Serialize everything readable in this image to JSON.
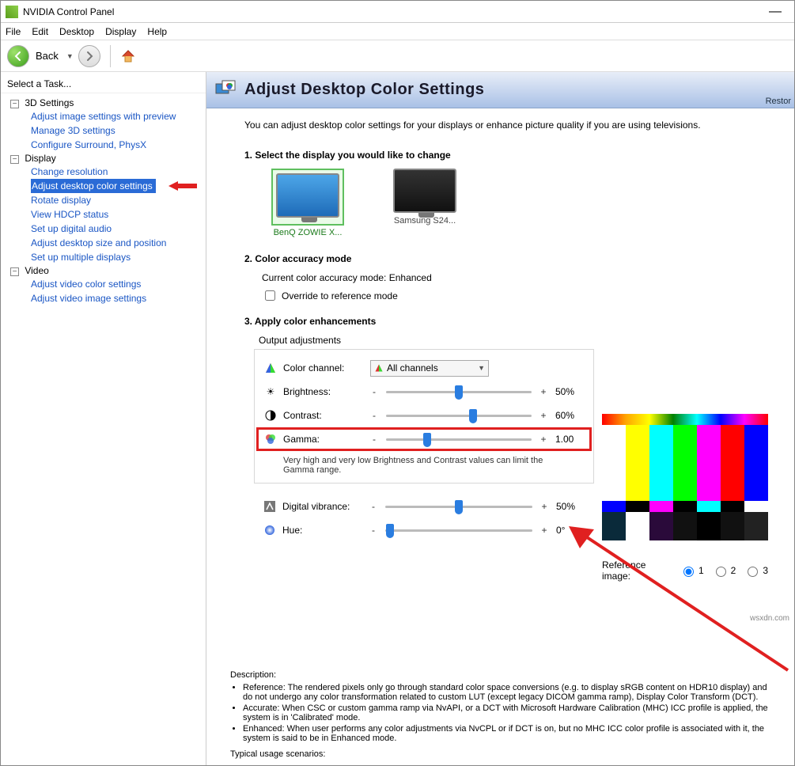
{
  "window": {
    "title": "NVIDIA Control Panel"
  },
  "menu": {
    "file": "File",
    "edit": "Edit",
    "desktop": "Desktop",
    "display": "Display",
    "help": "Help"
  },
  "toolbar": {
    "back": "Back"
  },
  "sidebar": {
    "header": "Select a Task...",
    "g3d": {
      "label": "3D Settings",
      "a": "Adjust image settings with preview",
      "b": "Manage 3D settings",
      "c": "Configure Surround, PhysX"
    },
    "disp": {
      "label": "Display",
      "a": "Change resolution",
      "b": "Adjust desktop color settings",
      "c": "Rotate display",
      "d": "View HDCP status",
      "e": "Set up digital audio",
      "f": "Adjust desktop size and position",
      "g": "Set up multiple displays"
    },
    "video": {
      "label": "Video",
      "a": "Adjust video color settings",
      "b": "Adjust video image settings"
    }
  },
  "page": {
    "title": "Adjust Desktop Color Settings",
    "restore": "Restor",
    "intro": "You can adjust desktop color settings for your displays or enhance picture quality if you are using televisions.",
    "step1": "1. Select the display you would like to change",
    "disp1": "BenQ ZOWIE X...",
    "disp2": "Samsung S24...",
    "step2": "2. Color accuracy mode",
    "curmode": "Current color accuracy mode: Enhanced",
    "override": "Override to reference mode",
    "step3": "3. Apply color enhancements",
    "outadj": "Output adjustments",
    "colorchannel": "Color channel:",
    "allchannels": "All channels",
    "brightness": "Brightness:",
    "bval": "50%",
    "contrast": "Contrast:",
    "cval": "60%",
    "gamma": "Gamma:",
    "gval": "1.00",
    "tip": "Very high and very low Brightness and Contrast values can limit the Gamma range.",
    "dvib": "Digital vibrance:",
    "dval": "50%",
    "hue": "Hue:",
    "hval": "0°",
    "refimg": "Reference image:",
    "r1": "1",
    "r2": "2",
    "r3": "3",
    "deschead": "Description:",
    "desc_ref": "Reference: The rendered pixels only go through standard color space conversions (e.g. to display sRGB content on HDR10 display) and do not undergo any color transformation related to custom LUT (except legacy DICOM gamma ramp), Display Color Transform (DCT).",
    "desc_acc": "Accurate: When CSC or custom gamma ramp via NvAPI, or a DCT with Microsoft Hardware Calibration (MHC) ICC profile is applied, the system is in 'Calibrated' mode.",
    "desc_enh": "Enhanced: When user performs any color adjustments via NvCPL or if DCT is on, but no MHC ICC color profile is associated with it, the system is said to be in Enhanced mode.",
    "usage": "Typical usage scenarios:"
  },
  "watermark": "wsxdn.com"
}
